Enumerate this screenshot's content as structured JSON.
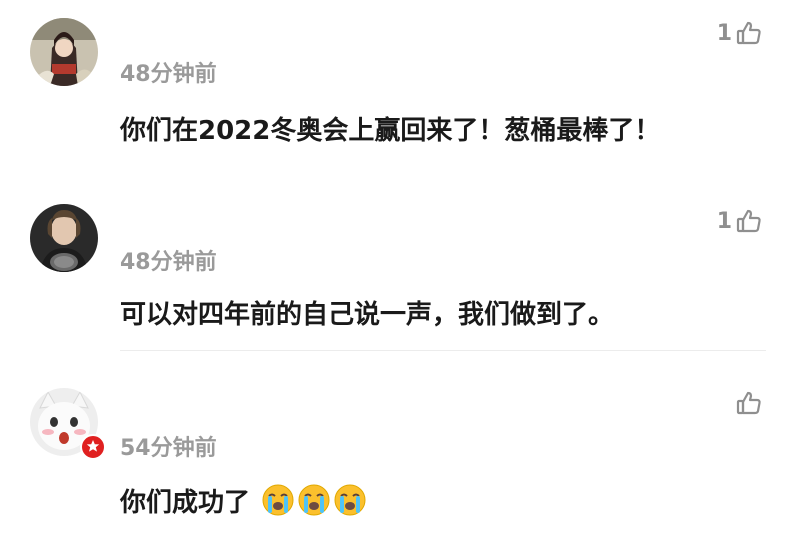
{
  "comments": [
    {
      "time": "48分钟前",
      "text": "你们在2022冬奥会上赢回来了！葱桶最棒了！",
      "likes": "1",
      "avatar": "anime-character-avatar"
    },
    {
      "time": "48分钟前",
      "text": "可以对四年前的自己说一声，我们做到了。",
      "likes": "1",
      "avatar": "athlete-photo-avatar"
    },
    {
      "time": "54分钟前",
      "text": "你们成功了",
      "likes": "",
      "avatar": "white-cat-avatar",
      "emojis": [
        "crying-face-emoji",
        "crying-face-emoji",
        "crying-face-emoji"
      ],
      "verified_badge": true
    }
  ],
  "colors": {
    "text": "#1a1a1a",
    "meta": "#9a9a9a",
    "badge": "#e02020"
  }
}
